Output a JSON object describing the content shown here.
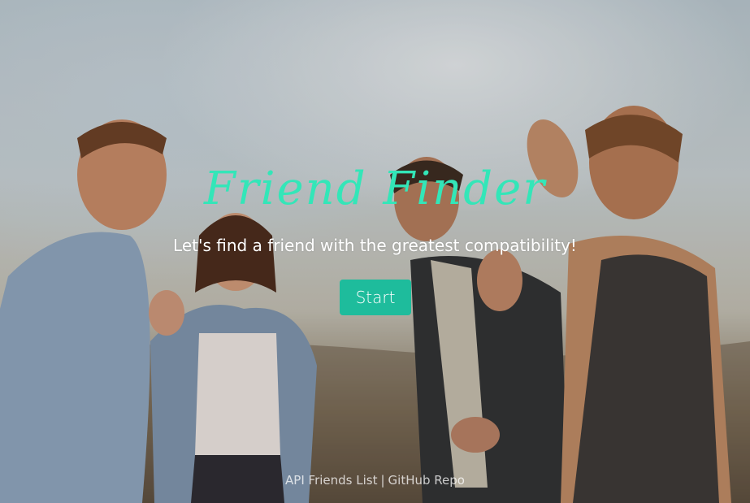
{
  "hero": {
    "title": "Friend Finder",
    "subtitle": "Let's find a friend with the greatest compatibility!",
    "start_label": "Start",
    "accent_color": "#33e6b8",
    "button_color": "#1ebc9c"
  },
  "footer": {
    "api_link": "API Friends List",
    "separator": "|",
    "repo_link": "GitHub Repo"
  }
}
